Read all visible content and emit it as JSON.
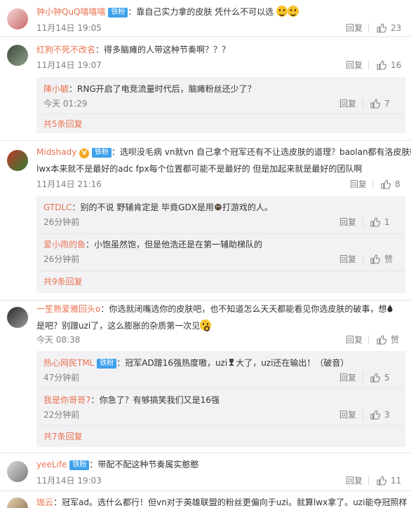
{
  "labels": {
    "reply": "回复",
    "zan": "赞"
  },
  "colors": {
    "username": "#eb7350",
    "badge": "#3ea1ec",
    "meta": "#808080",
    "sub_bg": "#f2f2f5"
  },
  "comments": [
    {
      "user": "钟小钟QuQ嘻嘻嘻",
      "badge": "铁粉",
      "sep": "：",
      "text": "靠自己实力拿的皮肤 凭什么不可以选",
      "time": "11月14日 19:05",
      "likes": "23"
    },
    {
      "user": "红狗不死不改名",
      "sep": "：",
      "text": "得多脑瘫的人带这种节奏啊？？？",
      "time": "11月14日 19:07",
      "likes": "16",
      "replies": [
        {
          "user": "陳小毓",
          "sep": "：",
          "text": "RNG开启了电竞流量时代后，脑瘫粉丝还少了？",
          "time": "今天 01:29",
          "likes": "7"
        }
      ],
      "more": "共5条回复"
    },
    {
      "user": "Midshady",
      "vip": "V",
      "badge": "铁粉",
      "sep": "：",
      "text": "选呗没毛病 vn就vn 自己拿个冠军还有不让选皮肤的道理？baolan都有洛皮肤呢",
      "text2": "lwx本来就不是最好的adc fpx每个位置都可能不是最好的 但是加起来就是最好的团队啊",
      "time": "11月14日 21:16",
      "likes": "8",
      "replies": [
        {
          "user": "GTDLC",
          "sep": "：",
          "text": "别的不说 野辅肯定是 毕竟GDX是用",
          "text_b": "打游戏的人。",
          "time": "26分钟前",
          "likes": "1"
        },
        {
          "user": "爱小雨的鱼",
          "sep": "：",
          "text": "小饱虽然饱，但是他浩还是在第一辅助梯队的",
          "time": "26分钟前",
          "likes": "赞"
        }
      ],
      "more": "共9条回复"
    },
    {
      "user": "一笙熟爱雅回头o",
      "sep": "：",
      "text": "你选就闭嘴选你的皮肤吧，也不知道怎么天天都能看见你选皮肤的破事，想",
      "text2": "是吧？别蹭uzi了，这么膨胀的杂质第一次见",
      "time": "今天 08:38",
      "likes": "赞",
      "replies": [
        {
          "user": "热心网民TML",
          "badge": "铁粉",
          "sep": "：",
          "text": "冠军AD蹭16强热度嗷，uzi",
          "text_b": "大了，uzi还在输出！（破音）",
          "time": "47分钟前",
          "likes": "5"
        },
        {
          "user": "我是你哥哥7",
          "sep": "：",
          "text": "你急了？有够搞笑我们又是16强",
          "time": "22分钟前",
          "likes": "3"
        }
      ],
      "more": "共7条回复"
    },
    {
      "user": "yeeLife",
      "badge": "铁粉",
      "sep": "：",
      "text": "带配不配这种节奏属实憨憨",
      "time": "11月14日 19:03",
      "likes": "11"
    },
    {
      "user": "珈云",
      "sep": "：",
      "text": "冠军ad。选什么都行！但vn对于英雄联盟的粉丝更偏向于uzi。就算lwx拿了。uzi能夺冠照样"
    }
  ]
}
